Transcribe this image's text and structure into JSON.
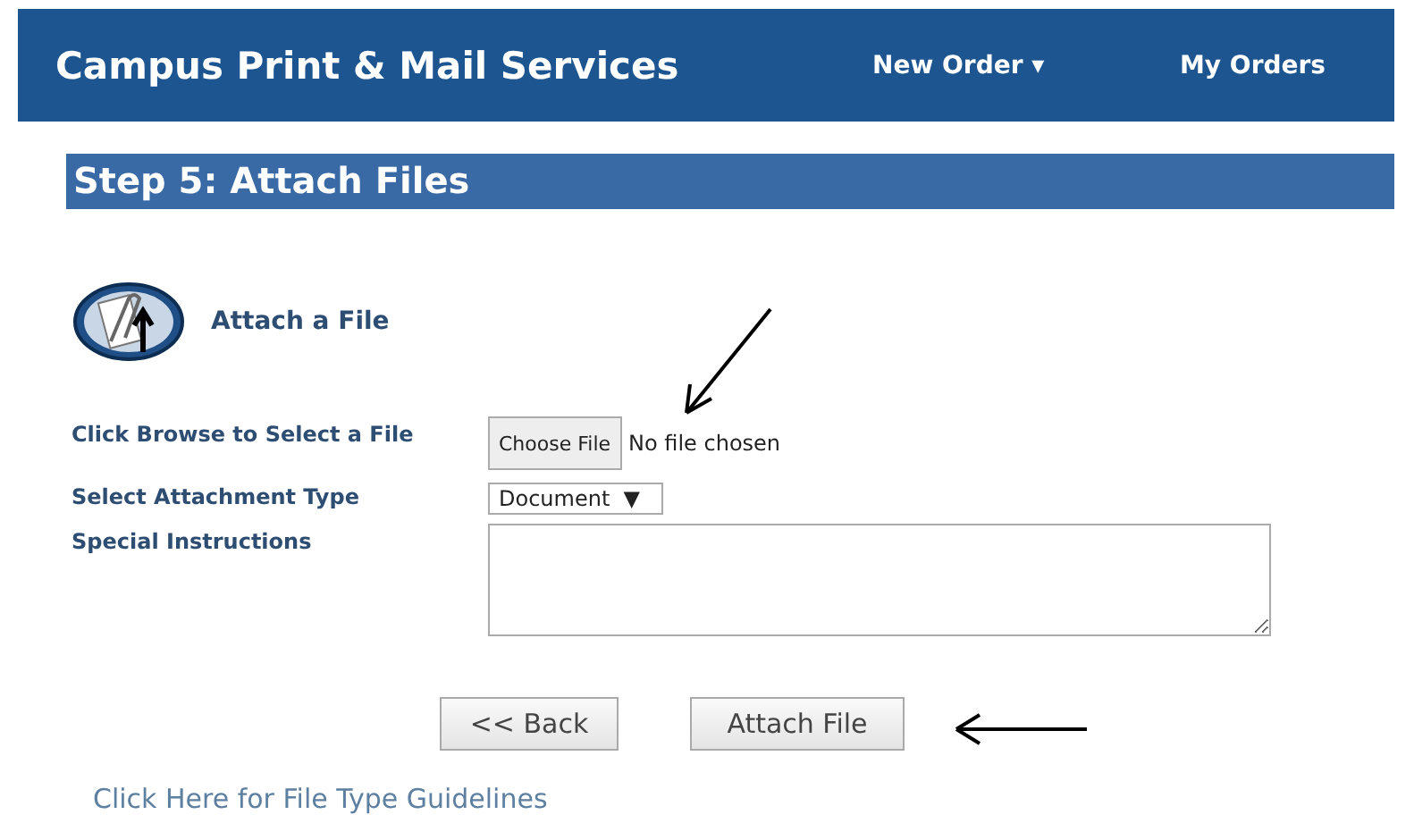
{
  "header": {
    "title": "Campus Print & Mail Services",
    "nav": [
      {
        "label": "New Order",
        "caret": "▾"
      },
      {
        "label": "My Orders"
      }
    ]
  },
  "step": {
    "title": "Step 5: Attach Files"
  },
  "section": {
    "title": "Attach a File"
  },
  "fields": [
    {
      "kind": "file",
      "label": "Click Browse to Select a File",
      "button": "Choose File",
      "status": "No file chosen"
    },
    {
      "kind": "select",
      "label": "Select Attachment Type",
      "value": "Document",
      "caret": "▼"
    },
    {
      "kind": "textarea",
      "label": "Special Instructions"
    }
  ],
  "buttons": [
    "<< Back",
    "Attach File"
  ],
  "link": "Click Here for File Type Guidelines"
}
